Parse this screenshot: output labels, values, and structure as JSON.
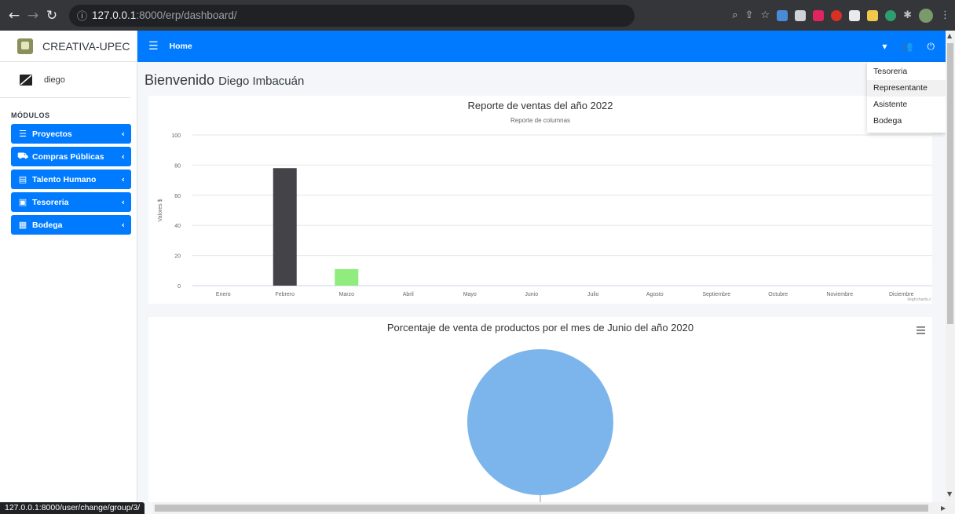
{
  "browser": {
    "url_host": "127.0.0.1",
    "url_path": ":8000/erp/dashboard/",
    "status_url": "127.0.0.1:8000/user/change/group/3/"
  },
  "sidebar": {
    "brand": "CREATIVA-UPEC",
    "user": "diego",
    "section_title": "MÓDULOS",
    "items": [
      {
        "label": "Proyectos",
        "icon": "list-icon"
      },
      {
        "label": "Compras Públicas",
        "icon": "cart-icon"
      },
      {
        "label": "Talento Humano",
        "icon": "id-card-icon"
      },
      {
        "label": "Tesoreria",
        "icon": "calendar-check-icon"
      },
      {
        "label": "Bodega",
        "icon": "boxes-icon"
      }
    ]
  },
  "topbar": {
    "home": "Home"
  },
  "dropdown": {
    "items": [
      "Tesoreria",
      "Representante",
      "Asistente",
      "Bodega"
    ],
    "active_index": 1
  },
  "welcome": {
    "text": "Bienvenido",
    "name": "Diego Imbacuán"
  },
  "colors": {
    "primary": "#007bff",
    "bar_dark": "#434348",
    "bar_green": "#90ed7d",
    "pie_blue": "#7cb5ec"
  },
  "chart_data": [
    {
      "type": "bar",
      "title": "Reporte de ventas del año 2022",
      "subtitle": "Reporte de columnas",
      "ylabel": "Valores $",
      "ylim": [
        0,
        100
      ],
      "yticks": [
        0,
        20,
        40,
        60,
        80,
        100
      ],
      "categories": [
        "Enero",
        "Febrero",
        "Marzo",
        "Abril",
        "Mayo",
        "Junio",
        "Julio",
        "Agosto",
        "Septiembre",
        "Octubre",
        "Noviembre",
        "Diciembre"
      ],
      "values": [
        0,
        78,
        11,
        0,
        0,
        0,
        0,
        0,
        0,
        0,
        0,
        0
      ],
      "bar_colors": [
        "#7cb5ec",
        "#434348",
        "#90ed7d",
        "#f7a35c",
        "#8085e9",
        "#f15c80",
        "#e4d354",
        "#2b908f",
        "#f45b5b",
        "#91e8e1",
        "#7cb5ec",
        "#434348"
      ],
      "credits": "Highcharts.c",
      "grid": true
    },
    {
      "type": "pie",
      "title": "Porcentaje de venta de productos por el mes de Junio del año 2020",
      "values": [
        100
      ],
      "colors": [
        "#7cb5ec"
      ]
    }
  ]
}
